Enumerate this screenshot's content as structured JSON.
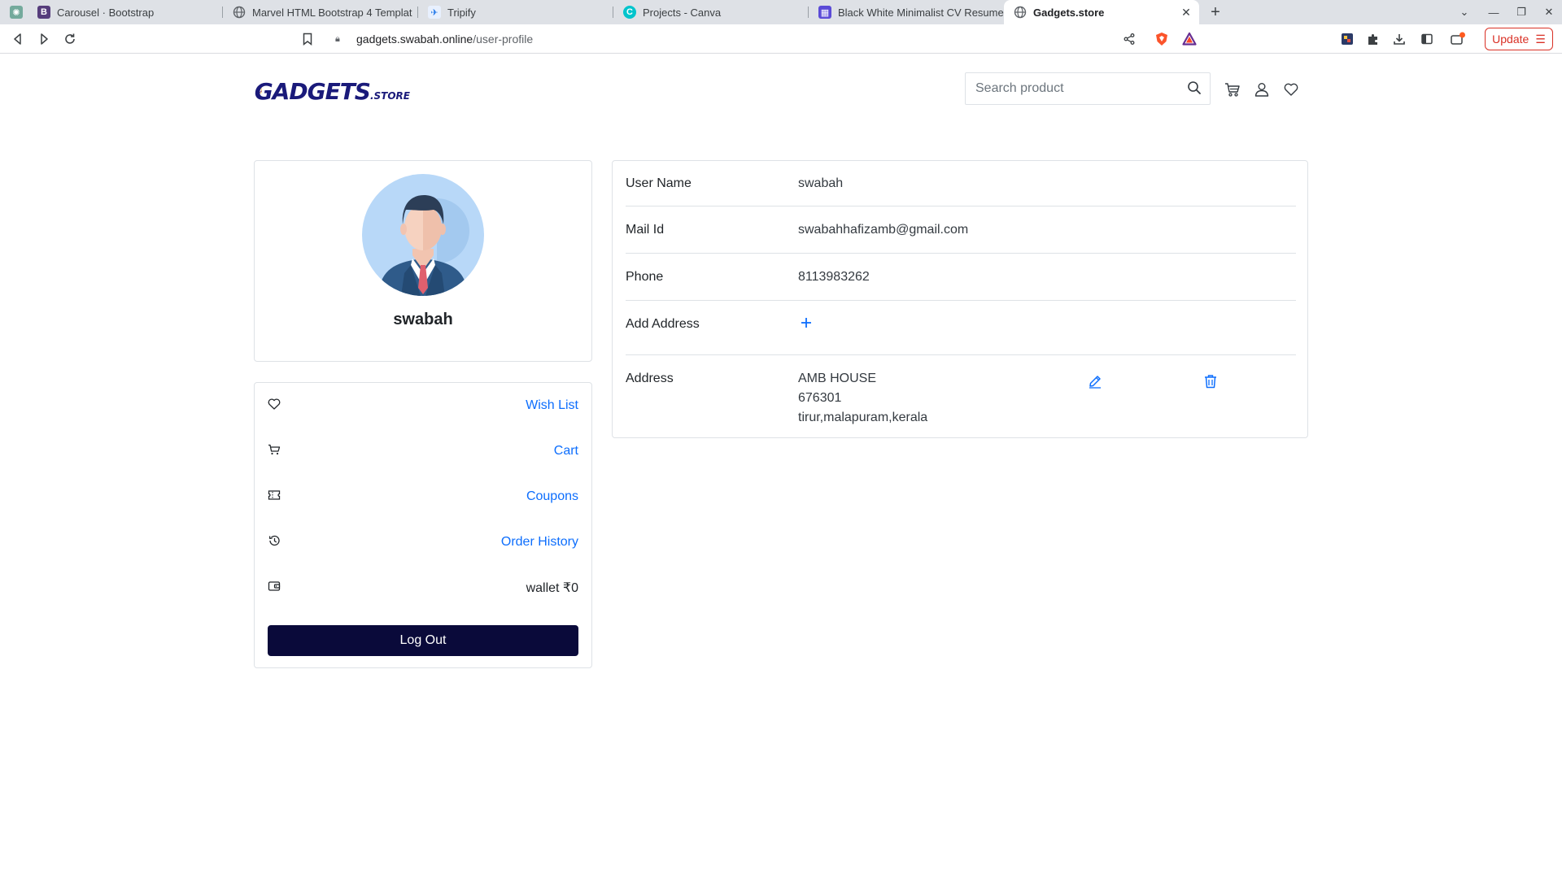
{
  "browser": {
    "tabs": [
      {
        "title": "",
        "favicon": "chatgpt-icon"
      },
      {
        "title": "Carousel · Bootstrap",
        "favicon": "bootstrap-icon"
      },
      {
        "title": "Marvel HTML Bootstrap 4 Templat",
        "favicon": "globe-icon"
      },
      {
        "title": "Tripify",
        "favicon": "tripify-icon"
      },
      {
        "title": "Projects - Canva",
        "favicon": "canva-icon"
      },
      {
        "title": "Black White Minimalist CV Resume",
        "favicon": "canva-doc-icon"
      },
      {
        "title": "Gadgets.store",
        "favicon": "globe-icon"
      }
    ],
    "url_host": "gadgets.swabah.online",
    "url_path": "/user-profile",
    "update_label": "Update"
  },
  "header": {
    "logo_main": "GADGETS",
    "logo_sub": ".STORE",
    "search_placeholder": "Search product"
  },
  "profile": {
    "name": "swabah"
  },
  "menu": {
    "items": [
      {
        "label": "Wish List",
        "icon": "heart-icon"
      },
      {
        "label": "Cart",
        "icon": "cart-icon"
      },
      {
        "label": "Coupons",
        "icon": "coupon-icon"
      },
      {
        "label": "Order History",
        "icon": "history-icon"
      },
      {
        "label": "wallet ₹0",
        "icon": "wallet-icon"
      }
    ],
    "logout_label": "Log Out"
  },
  "details": {
    "username_label": "User Name",
    "username_value": "swabah",
    "mail_label": "Mail Id",
    "mail_value": "swabahhafizamb@gmail.com",
    "phone_label": "Phone",
    "phone_value": "8113983262",
    "add_address_label": "Add Address",
    "address_label": "Address",
    "address_line1": "AMB HOUSE",
    "address_line2": "676301",
    "address_line3": "tirur,malapuram,kerala"
  },
  "colors": {
    "link": "#0d6efd",
    "logout_bg": "#0a0a3a",
    "border": "#dee2e6"
  }
}
